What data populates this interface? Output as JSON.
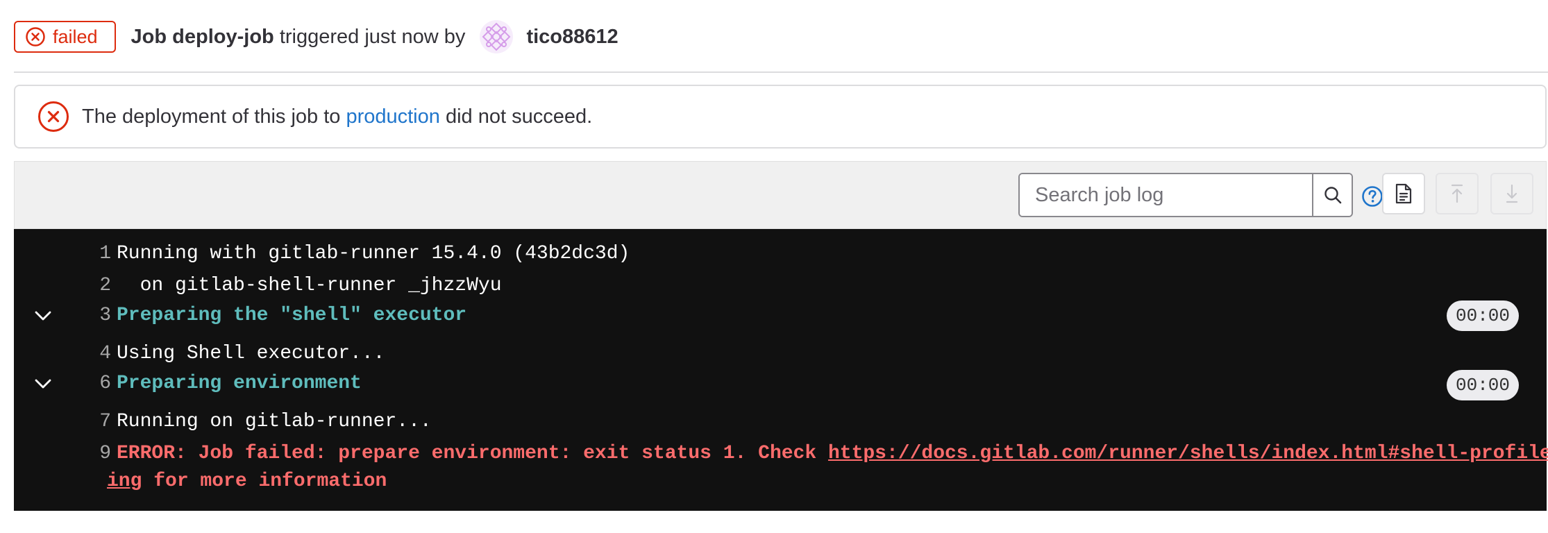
{
  "header": {
    "status": "failed",
    "job_prefix": "Job",
    "job_name": "deploy-job",
    "triggered_text": "triggered just now by",
    "username": "tico88612"
  },
  "alert": {
    "text_before": "The deployment of this job to",
    "environment_link": "production",
    "text_after": "did not succeed."
  },
  "toolbar": {
    "search_placeholder": "Search job log",
    "icons": [
      "search-icon",
      "question-icon",
      "raw-log-icon",
      "scroll-top-icon",
      "scroll-bottom-icon"
    ]
  },
  "log": {
    "lines": [
      {
        "num": "1",
        "text": "Running with gitlab-runner 15.4.0 (43b2dc3d)"
      },
      {
        "num": "2",
        "text": "  on gitlab-shell-runner _jhzzWyu"
      },
      {
        "num": "3",
        "text": "Preparing the \"shell\" executor",
        "duration": "00:00"
      },
      {
        "num": "4",
        "text": "Using Shell executor..."
      },
      {
        "num": "6",
        "text": "Preparing environment",
        "duration": "00:00"
      },
      {
        "num": "7",
        "text": "Running on gitlab-runner..."
      },
      {
        "num": "9",
        "error_prefix": "ERROR: Job failed: prepare environment: exit status 1. Check ",
        "link_part1": "https://docs.gitlab.com/runner/shells/index.html#shell-profile-load",
        "link_part2": "ing",
        "error_suffix": " for more information"
      }
    ]
  },
  "colors": {
    "failed": "#dd2b0e",
    "link": "#1f75cb",
    "log_background": "#111111",
    "section_header": "#5fbdbd",
    "error": "#fb6c6c"
  }
}
